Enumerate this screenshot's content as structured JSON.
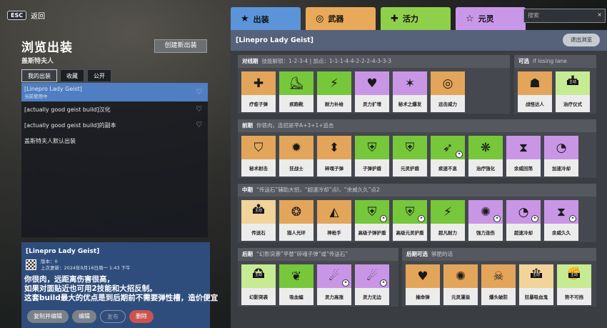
{
  "nav": {
    "esc": "ESC",
    "back": "返回"
  },
  "left": {
    "title": "浏览出装",
    "hero": "盖斯特夫人",
    "new_build": "创建新出装",
    "tabs": [
      "我的出装",
      "收藏",
      "公开"
    ],
    "builds": [
      {
        "name": "[Linepro Lady Geist]",
        "sub": "当前使用中"
      },
      {
        "name": "[actually good geist build]汉化",
        "sub": ""
      },
      {
        "name": "[actually good geist build]的副本",
        "sub": ""
      },
      {
        "name": "盖斯特夫人默认出装",
        "sub": ""
      }
    ]
  },
  "card": {
    "name": "[Linepro Lady Geist]",
    "version": "版本：0",
    "updated": "上次更新：2024年9月16日周一 1:43 下午",
    "desc": [
      "你很肉，远距离伤害很高，",
      "如果对面贴近也可用2技能和大招反制。",
      "这套build最大的优点是到后期前不需要弹性槽，造价便宜"
    ],
    "buttons": [
      "复制并编辑",
      "编辑",
      "发布",
      "删除"
    ]
  },
  "right": {
    "tabs": [
      {
        "label": "出装",
        "icon": "star-icon",
        "color": "#5b94d8"
      },
      {
        "label": "武器",
        "icon": "weapon-icon",
        "color": "#e8a95b"
      },
      {
        "label": "活力",
        "icon": "vitality-icon",
        "color": "#8fd04b"
      },
      {
        "label": "元灵",
        "icon": "spirit-icon",
        "color": "#c897e8"
      }
    ],
    "search_placeholder": "搜索",
    "build_title": "[Linepro Lady Geist]",
    "exit": "退出浏览",
    "sections": [
      {
        "title": "对线期",
        "hint": "技能解锁：1-2-3-4 | 加点：1-1-1-4-4-2-2-2-4-3-3-3",
        "items": [
          {
            "label": "疗愈子弹",
            "color": "o",
            "icon": "✚"
          },
          {
            "label": "疾跑靴",
            "color": "g",
            "icon": "⛸"
          },
          {
            "label": "耐力补给",
            "color": "g",
            "icon": "⚡"
          },
          {
            "label": "灵力扩增",
            "color": "p",
            "icon": "♥"
          },
          {
            "label": "秘术之爆发",
            "color": "p",
            "icon": "✶"
          },
          {
            "label": "远击威力",
            "color": "o",
            "icon": "◎"
          }
        ]
      },
      {
        "title": "可选",
        "hint": "if losing lane",
        "items": [
          {
            "label": "战怪达人",
            "color": "o",
            "icon": "☗"
          },
          {
            "label": "治疗仪式",
            "color": "l",
            "icon": "✚",
            "tag": "主动"
          }
        ]
      },
      {
        "title": "前期",
        "hint": "你很肉，连招是平A+3+1+追击",
        "items": [
          {
            "label": "秘术射击",
            "color": "o",
            "icon": "⛉"
          },
          {
            "label": "狂战士",
            "color": "o",
            "icon": "✹"
          },
          {
            "label": "碎魂子弹",
            "color": "o",
            "icon": "⬍"
          },
          {
            "label": "子弹护盾",
            "color": "g",
            "icon": "⛨"
          },
          {
            "label": "元灵护盾",
            "color": "g",
            "icon": "⛨"
          },
          {
            "label": "疾速不息",
            "color": "g",
            "icon": "➶",
            "mini": true
          },
          {
            "label": "治疗强化",
            "color": "g",
            "icon": "❋"
          },
          {
            "label": "余威回荡",
            "color": "p",
            "icon": "⧗"
          },
          {
            "label": "加速冷却",
            "color": "p",
            "icon": "◔"
          }
        ]
      },
      {
        "title": "中期",
        "hint": "“传送石”辅助大招，“超速冷却”点I，“余威久久”点2",
        "items": [
          {
            "label": "传送石",
            "color": "c",
            "icon": "✤",
            "tag": "主动"
          },
          {
            "label": "猎人光环",
            "color": "o",
            "icon": "❂"
          },
          {
            "label": "神枪手",
            "color": "o",
            "icon": "◭"
          },
          {
            "label": "高级子弹护盾",
            "color": "g",
            "icon": "⛨",
            "mini": true
          },
          {
            "label": "高级元灵护盾",
            "color": "g",
            "icon": "⛨",
            "mini": true
          },
          {
            "label": "超凡耐力",
            "color": "g",
            "icon": "⚡"
          },
          {
            "label": "强力连伤",
            "color": "p",
            "icon": "✺",
            "mini": true
          },
          {
            "label": "超速冷却",
            "color": "p",
            "icon": "◔",
            "mini": true
          },
          {
            "label": "余威久久",
            "color": "p",
            "icon": "⧗",
            "mini": true
          }
        ]
      },
      {
        "title": "后期",
        "hint": "“幻影突袭”平替“碎魂子弹”或“传送石”",
        "items": [
          {
            "label": "幻影突袭",
            "color": "l",
            "icon": "✪",
            "tag": "主动"
          },
          {
            "label": "吸血蝠",
            "color": "g",
            "icon": "❦"
          },
          {
            "label": "灵力高涨",
            "color": "p",
            "icon": "☄",
            "mini": true
          },
          {
            "label": "灵力无边",
            "color": "p",
            "icon": "☄",
            "mini": true
          }
        ]
      },
      {
        "title": "后期可选",
        "hint": "够肥的话",
        "items": [
          {
            "label": "摧命弹",
            "color": "o",
            "icon": "♥"
          },
          {
            "label": "元灵漫溢",
            "color": "o",
            "icon": "✺"
          },
          {
            "label": "爆头破防",
            "color": "o",
            "icon": "☠"
          },
          {
            "label": "狂暴吸血鬼",
            "color": "c",
            "icon": "♆",
            "tag": "主动"
          },
          {
            "label": "势不可挡",
            "color": "l",
            "icon": "✊",
            "tag": "主动"
          }
        ]
      }
    ]
  }
}
